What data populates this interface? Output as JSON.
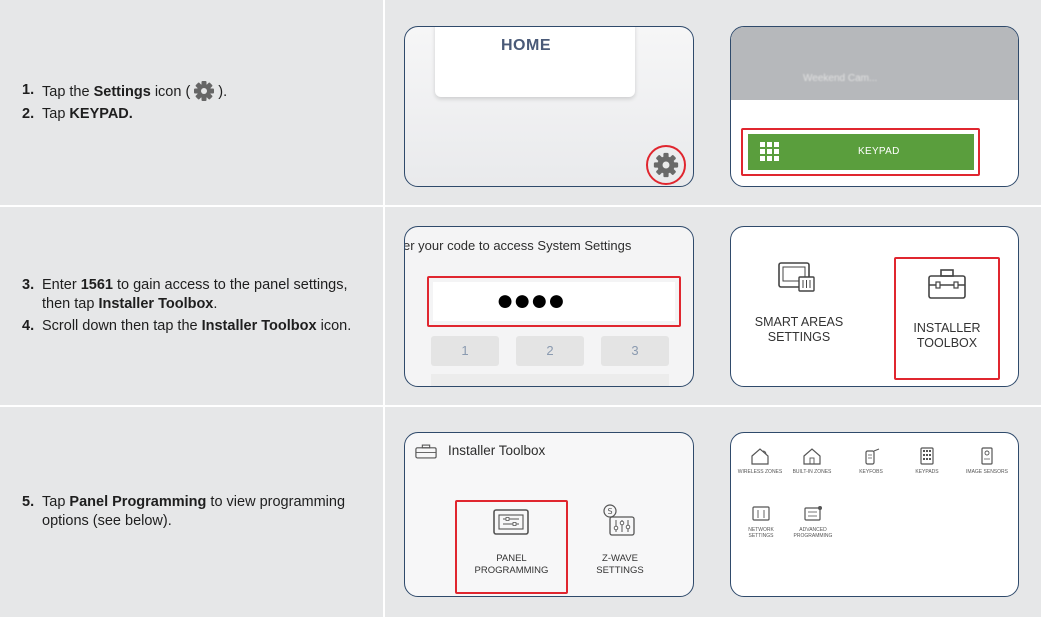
{
  "colors": {
    "row_bg": "#e6e7e8",
    "frame_border": "#2f4a6b",
    "highlight_red": "#e0262f",
    "keypad_green": "#5a9e3d",
    "gear_gray": "#666666"
  },
  "step1": {
    "num": "1.",
    "pre": "Tap the ",
    "bold": "Settings",
    "post_icon": " icon (",
    "close": ")."
  },
  "step2": {
    "num": "2.",
    "pre": "Tap ",
    "bold": "KEYPAD."
  },
  "step3": {
    "num": "3.",
    "pre": "Enter ",
    "bold1": "1561",
    "mid": " to gain access to the panel settings, then tap ",
    "bold2": "Installer Toolbox",
    "post": "."
  },
  "step4": {
    "num": "4.",
    "pre": "Scroll down then tap the ",
    "bold": "Installer Toolbox",
    "post": " icon."
  },
  "step5": {
    "num": "5.",
    "pre": "Tap ",
    "bold": "Panel Programming",
    "post": " to view programming options (see below)."
  },
  "shot_home": {
    "label": "HOME",
    "icon": "gear-icon"
  },
  "shot_keypad": {
    "blurred_header": "Weekend Cam...",
    "button_label": "KEYPAD",
    "icon": "keypad-grid-icon"
  },
  "shot_code": {
    "prompt": "er your code to access System Settings",
    "masked": "●●●●",
    "keys": [
      "1",
      "2",
      "3"
    ]
  },
  "shot_settings": {
    "smart_areas": [
      "SMART AREAS",
      "SETTINGS"
    ],
    "installer": [
      "INSTALLER",
      "TOOLBOX"
    ]
  },
  "shot_toolbox": {
    "title": "Installer Toolbox",
    "panel_programming": [
      "PANEL",
      "PROGRAMMING"
    ],
    "zwave": [
      "Z-WAVE",
      "SETTINGS"
    ]
  },
  "shot_programming": {
    "row1": [
      "WIRELESS ZONES",
      "BUILT-IN ZONES",
      "KEYFOBS",
      "KEYPADS",
      "IMAGE SENSORS"
    ],
    "row2a": [
      "NETWORK",
      "SETTINGS"
    ],
    "row2b": [
      "ADVANCED",
      "PROGRAMMING"
    ]
  }
}
